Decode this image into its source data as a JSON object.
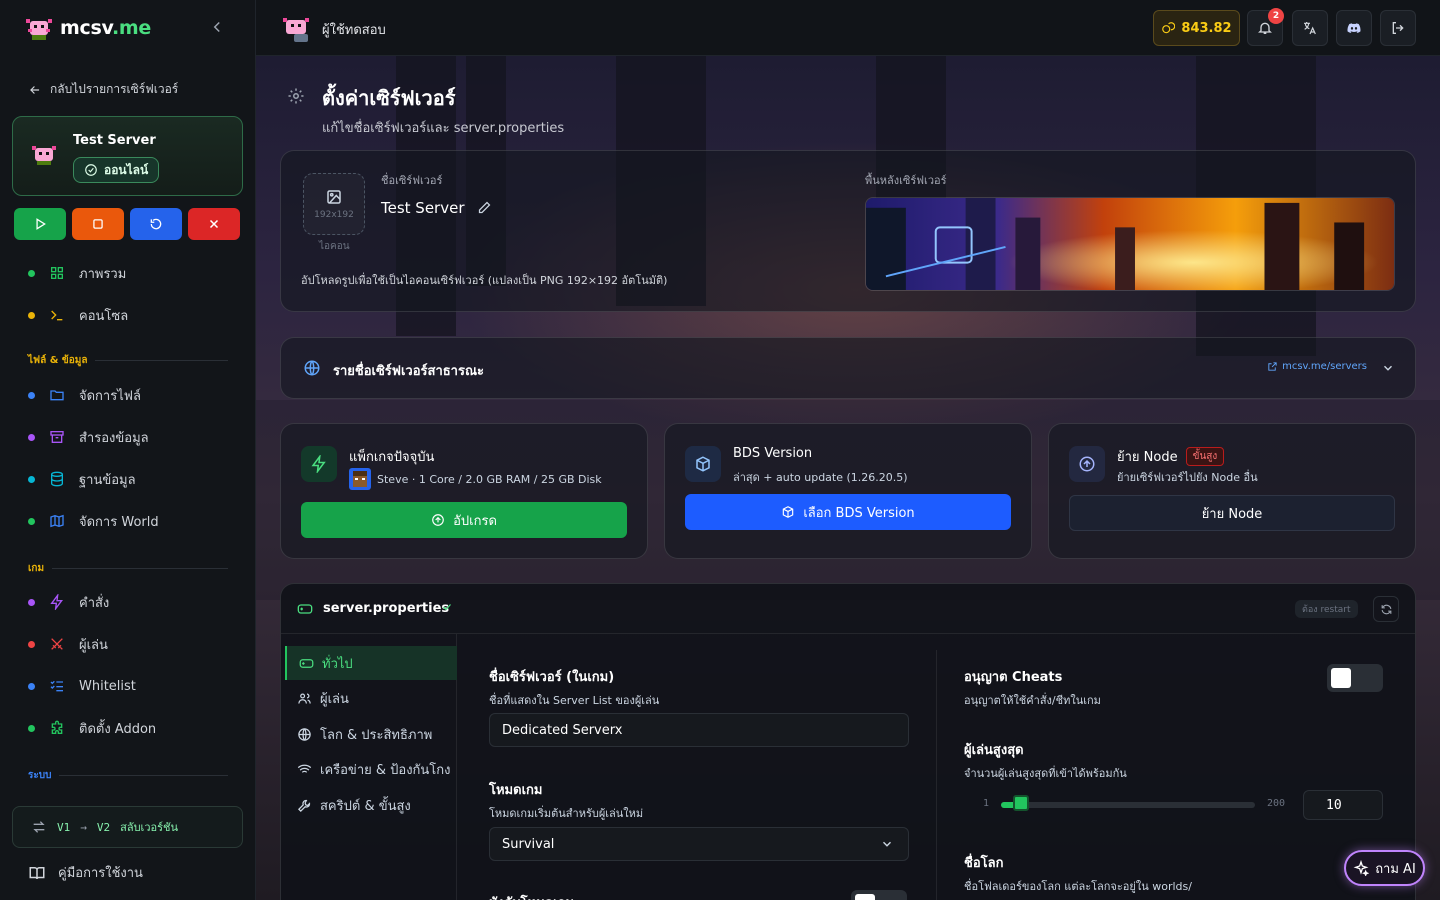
{
  "brand": {
    "name": "mcsv",
    "tld": ".me"
  },
  "sidebar": {
    "back_label": "กลับไปรายการเซิร์ฟเวอร์",
    "server": {
      "name": "Test Server",
      "status": "ออนไลน์"
    },
    "controls": [
      {
        "name": "start",
        "color": "#16a34a"
      },
      {
        "name": "stop",
        "color": "#ea580c"
      },
      {
        "name": "restart",
        "color": "#2563eb"
      },
      {
        "name": "kill",
        "color": "#dc2626"
      }
    ],
    "items_main": [
      {
        "label": "ภาพรวม",
        "dot": "#22c55e"
      },
      {
        "label": "คอนโซล",
        "dot": "#eab308"
      }
    ],
    "section_files": "ไฟล์ & ข้อมูล",
    "items_files": [
      {
        "label": "จัดการไฟล์",
        "dot": "#3b82f6"
      },
      {
        "label": "สำรองข้อมูล",
        "dot": "#a855f7"
      },
      {
        "label": "ฐานข้อมูล",
        "dot": "#06b6d4"
      },
      {
        "label": "จัดการ World",
        "dot": "#22c55e"
      }
    ],
    "section_game": "เกม",
    "items_game": [
      {
        "label": "คำสั่ง",
        "dot": "#a855f7"
      },
      {
        "label": "ผู้เล่น",
        "dot": "#ef4444"
      },
      {
        "label": "Whitelist",
        "dot": "#3b82f6"
      },
      {
        "label": "ติดตั้ง Addon",
        "dot": "#22c55e"
      }
    ],
    "section_system": "ระบบ",
    "version_switch": {
      "from": "V1",
      "arrow": "→",
      "to": "V2",
      "label": "สลับเวอร์ชัน"
    },
    "manual_label": "คู่มือการใช้งาน"
  },
  "topbar": {
    "username": "ผู้ใช้ทดสอบ",
    "coins": "843.82",
    "notifications": "2"
  },
  "page": {
    "title": "ตั้งค่าเซิร์ฟเวอร์",
    "subtitle": "แก้ไขชื่อเซิร์ฟเวอร์และ server.properties"
  },
  "identity": {
    "name_label": "ชื่อเซิร์ฟเวอร์",
    "name_value": "Test Server",
    "icon_size": "192x192",
    "icon_caption": "ไอคอน",
    "upload_hint": "อัปโหลดรูปเพื่อใช้เป็นไอคอนเซิร์ฟเวอร์ (แปลงเป็น PNG 192×192 อัตโนมัติ)",
    "background_label": "พื้นหลังเซิร์ฟเวอร์"
  },
  "public_list": {
    "title": "รายชื่อเซิร์ฟเวอร์สาธารณะ",
    "link": "mcsv.me/servers"
  },
  "package": {
    "title": "แพ็กเกจปัจจุบัน",
    "detail": "Steve · 1 Core / 2.0 GB RAM / 25 GB Disk",
    "button": "อัปเกรด"
  },
  "bds": {
    "title": "BDS Version",
    "detail": "ล่าสุด + auto update (1.26.20.5)",
    "button": "เลือก BDS Version"
  },
  "node": {
    "title": "ย้าย Node",
    "badge": "ขั้นสูง",
    "detail": "ย้ายเซิร์ฟเวอร์ไปยัง Node อื่น",
    "button": "ย้าย Node"
  },
  "props": {
    "title": "server.properties",
    "restart_note": "ต้อง restart",
    "tabs": [
      "ทั่วไป",
      "ผู้เล่น",
      "โลก & ประสิทธิภาพ",
      "เครือข่าย & ป้องกันโกง",
      "สคริปต์ & ขั้นสูง"
    ],
    "server_name": {
      "label": "ชื่อเซิร์ฟเวอร์ (ในเกม)",
      "desc": "ชื่อที่แสดงใน Server List ของผู้เล่น",
      "value": "Dedicated Serverx"
    },
    "gamemode": {
      "label": "โหมดเกม",
      "desc": "โหมดเกมเริ่มต้นสำหรับผู้เล่นใหม่",
      "value": "Survival"
    },
    "force_gamemode_label": "บังคับโหมดเกม",
    "cheats": {
      "label": "อนุญาต Cheats",
      "desc": "อนุญาตให้ใช้คำสั่ง/ชีทในเกม",
      "enabled": false
    },
    "max_players": {
      "label": "ผู้เล่นสูงสุด",
      "desc": "จำนวนผู้เล่นสูงสุดที่เข้าได้พร้อมกัน",
      "min": "1",
      "max": "200",
      "value": "10"
    },
    "level_name": {
      "label": "ชื่อโลก",
      "desc": "ชื่อโฟลเดอร์ของโลก แต่ละโลกจะอยู่ใน worlds/"
    }
  },
  "ai_button": "ถาม AI"
}
